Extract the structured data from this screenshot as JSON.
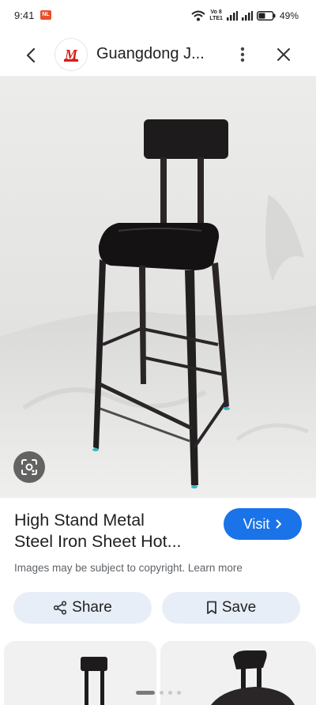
{
  "status_bar": {
    "time": "9:41",
    "notification_badge": "NL",
    "network_label_top": "Vo 8",
    "network_label_bottom": "LTE1",
    "battery": "49%"
  },
  "header": {
    "site_name": "Guangdong J...",
    "logo_letter": "M"
  },
  "product": {
    "title_line1": "High Stand Metal",
    "title_line2": "Steel Iron Sheet Hot...",
    "visit_label": "Visit",
    "copyright_text": "Images may be subject to copyright.",
    "learn_more": "Learn more"
  },
  "actions": {
    "share_label": "Share",
    "save_label": "Save"
  },
  "icons": {
    "back": "back-arrow-icon",
    "more": "more-vert-icon",
    "close": "close-icon",
    "lens": "lens-icon",
    "share": "share-icon",
    "save": "bookmark-icon"
  },
  "colors": {
    "accent": "#1a73e8",
    "button_bg": "#e8eef8",
    "logo_red": "#d3211f"
  }
}
